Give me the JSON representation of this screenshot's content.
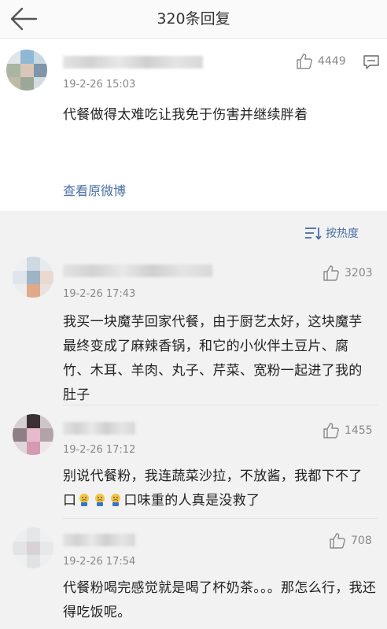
{
  "header": {
    "title": "320条回复"
  },
  "main_post": {
    "time": "19-2-26 15:03",
    "likes": "4449",
    "content": "代餐做得太难吃让我免于伤害并继续胖着",
    "link": "查看原微博"
  },
  "sort": {
    "label": "按热度"
  },
  "replies": [
    {
      "time": "19-2-26 17:43",
      "likes": "3203",
      "content": "我买一块魔芋回家代餐，由于厨艺太好，这块魔芋最终变成了麻辣香锅，和它的小伙伴土豆片、腐竹、木耳、羊肉、丸子、芹菜、宽粉一起进了我的肚子"
    },
    {
      "time": "19-2-26 17:12",
      "likes": "1455",
      "content_before": "别说代餐粉，我连蔬菜沙拉，不放酱，我都下不了口",
      "content_after": "口味重的人真是没救了",
      "emoji": "crying-emoji"
    },
    {
      "time": "19-2-26 17:54",
      "likes": "708",
      "content": "代餐粉喝完感觉就是喝了杯奶茶。。。那怎么行，我还得吃饭呢。"
    }
  ],
  "colors": {
    "link": "#4a6fa5",
    "meta": "#888888",
    "background": "#f2f2f2"
  }
}
